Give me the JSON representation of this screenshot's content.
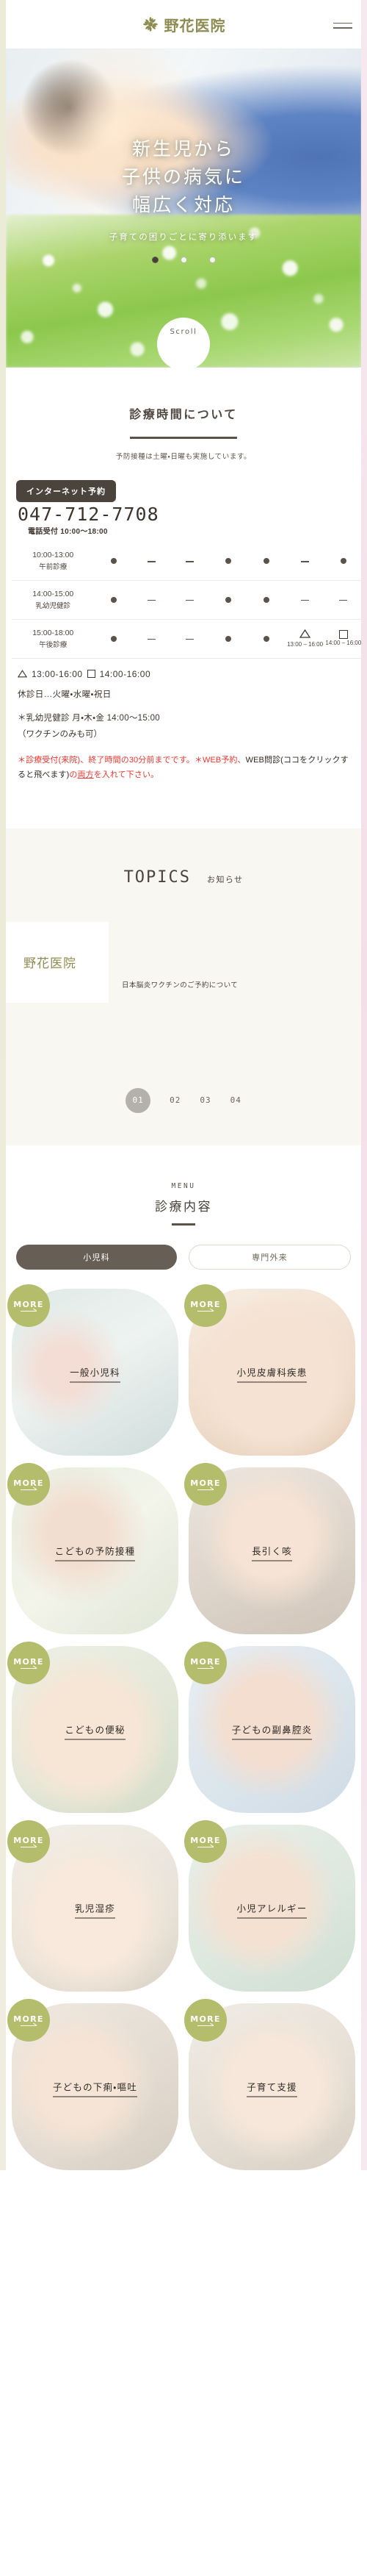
{
  "header": {
    "brand_name": "野花医院",
    "logo_icon": "flower-icon",
    "menu_icon": "hamburger-menu-icon"
  },
  "hero": {
    "headline_lines": [
      "新生児から",
      "子供の病気に",
      "幅広く対応"
    ],
    "subline": "子育ての困りごとに寄り添います",
    "scroll_label": "Scroll",
    "slider_dots": [
      "1",
      "2",
      "3"
    ],
    "active_dot_index": 0
  },
  "hours": {
    "title": "診療時間について",
    "note": "予防接種は土曜・日曜も実施しています。",
    "internet_booking_label": "インターネット予約",
    "tel": "047-712-7708",
    "tel_hours": "電話受付 10:00〜18:00",
    "rows": [
      {
        "time": "10:00-13:00",
        "name": "午前診療",
        "marks": [
          "dot",
          "dash",
          "dash",
          "dot",
          "dot",
          "dash",
          "dot"
        ],
        "mark_times": [
          "",
          "",
          "",
          "",
          "",
          "",
          ""
        ]
      },
      {
        "time": "14:00-15:00",
        "name": "乳幼児健診",
        "marks": [
          "dot",
          "dash",
          "dash",
          "dot",
          "dot",
          "dash",
          "dash"
        ],
        "mark_times": [
          "",
          "",
          "",
          "",
          "",
          "",
          ""
        ]
      },
      {
        "time": "15:00-18:00",
        "name": "午後診療",
        "marks": [
          "dot",
          "dash",
          "dash",
          "dot",
          "dot",
          "triangle",
          "square"
        ],
        "mark_times": [
          "",
          "",
          "",
          "",
          "",
          "13:00 – 16:00",
          "14:00 – 16:00"
        ]
      }
    ],
    "legend_triangle": "13:00-16:00",
    "legend_square": "14:00-16:00",
    "closed": "休診日…火曜・水曜・祝日",
    "note_checkup": "＊乳幼児健診 月・木・金 14:00〜15:00",
    "note_checkup2": "（ワクチンのみも可）",
    "warning_1": "＊診療受付(来院)、終了時間の30分前までです。＊WEB予約、",
    "warning_black": "WEB問診(ココをクリックすると飛べます)",
    "warning_2": "の",
    "warning_underline": "両方",
    "warning_3": "を入れて下さ",
    "warning_4": "い。"
  },
  "topics": {
    "title_en": "TOPICS",
    "title_jp": "お知らせ",
    "card": {
      "thumb_brand": "野花医院",
      "text": "日本脳炎ワクチンのご予約について"
    },
    "pager": [
      "01",
      "02",
      "03",
      "04"
    ],
    "active_page": "01"
  },
  "menu": {
    "title_en": "MENU",
    "title_jp": "診療内容",
    "tabs": [
      {
        "label": "小児科",
        "active": true
      },
      {
        "label": "専門外来",
        "active": false
      }
    ],
    "more_label": "MORE",
    "cards": [
      {
        "label": "一般小児科",
        "photo": "ph1"
      },
      {
        "label": "小児皮膚科疾患",
        "photo": "ph2"
      },
      {
        "label": "こどもの予防接種",
        "photo": "ph3"
      },
      {
        "label": "長引く咳",
        "photo": "ph4"
      },
      {
        "label": "こどもの便秘",
        "photo": "ph5"
      },
      {
        "label": "子どもの副鼻腔炎",
        "photo": "ph6"
      },
      {
        "label": "乳児湿疹",
        "photo": "ph7"
      },
      {
        "label": "小児アレルギー",
        "photo": "ph8"
      },
      {
        "label": "子どもの下痢・嘔吐",
        "photo": "ph9"
      },
      {
        "label": "子育て支援",
        "photo": "ph10"
      }
    ]
  },
  "colors": {
    "brand_olive": "#8d8b52",
    "accent_green": "#b3bd6c",
    "dark": "#4a443d",
    "warn_red": "#e8352e",
    "cream": "#f8f7f1"
  }
}
